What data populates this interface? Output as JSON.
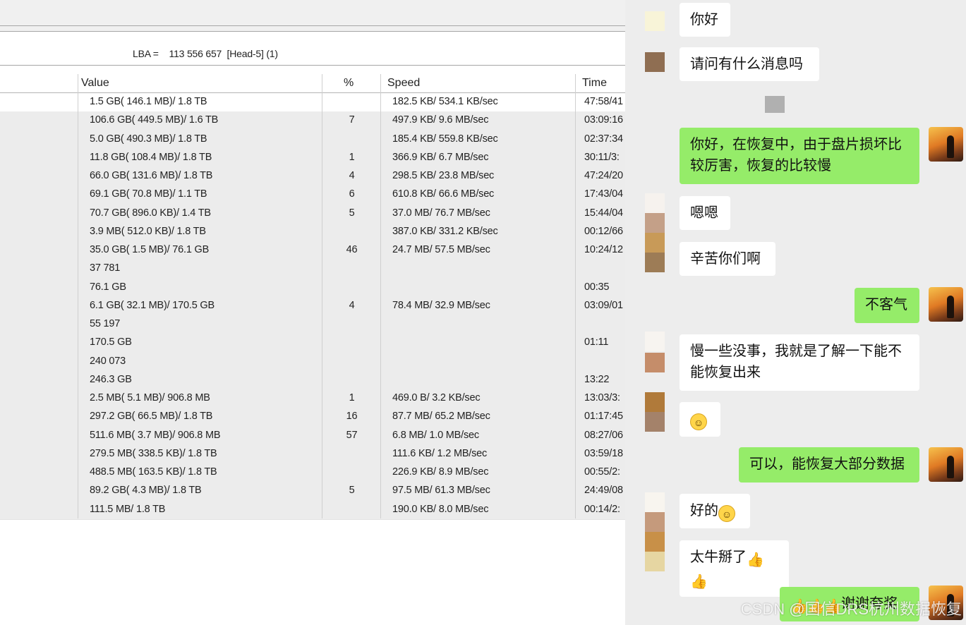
{
  "lba": {
    "label": "LBA =",
    "value": "113 556 657",
    "head": "[Head-5] (1)"
  },
  "table": {
    "headers": {
      "value": "Value",
      "pct": "%",
      "speed": "Speed",
      "time": "Time"
    },
    "rows": [
      {
        "value": "1.5 GB( 146.1 MB)/ 1.8 TB",
        "pct": "",
        "speed": "182.5 KB/ 534.1 KB/sec",
        "time": "47:58/41"
      },
      {
        "value": "106.6 GB( 449.5 MB)/ 1.6 TB",
        "pct": "7",
        "speed": "497.9 KB/ 9.6 MB/sec",
        "time": "03:09:16"
      },
      {
        "value": "5.0 GB( 490.3 MB)/ 1.8 TB",
        "pct": "",
        "speed": "185.4 KB/ 559.8 KB/sec",
        "time": "02:37:34"
      },
      {
        "value": "11.8 GB( 108.4 MB)/ 1.8 TB",
        "pct": "1",
        "speed": "366.9 KB/ 6.7 MB/sec",
        "time": "30:11/3:"
      },
      {
        "value": "66.0 GB( 131.6 MB)/ 1.8 TB",
        "pct": "4",
        "speed": "298.5 KB/ 23.8 MB/sec",
        "time": "47:24/20"
      },
      {
        "value": "69.1 GB( 70.8 MB)/ 1.1 TB",
        "pct": "6",
        "speed": "610.8 KB/ 66.6 MB/sec",
        "time": "17:43/04"
      },
      {
        "value": "70.7 GB( 896.0 KB)/ 1.4 TB",
        "pct": "5",
        "speed": "37.0 MB/ 76.7 MB/sec",
        "time": "15:44/04"
      },
      {
        "value": "3.9 MB( 512.0 KB)/ 1.8 TB",
        "pct": "",
        "speed": "387.0 KB/ 331.2 KB/sec",
        "time": "00:12/66"
      },
      {
        "value": "35.0 GB( 1.5 MB)/ 76.1 GB",
        "pct": "46",
        "speed": "24.7 MB/ 57.5 MB/sec",
        "time": "10:24/12"
      },
      {
        "value": "37 781",
        "pct": "",
        "speed": "",
        "time": ""
      },
      {
        "value": "76.1 GB",
        "pct": "",
        "speed": "",
        "time": "00:35"
      },
      {
        "value": "6.1 GB( 32.1 MB)/ 170.5 GB",
        "pct": "4",
        "speed": "78.4 MB/ 32.9 MB/sec",
        "time": "03:09/01"
      },
      {
        "value": "55 197",
        "pct": "",
        "speed": "",
        "time": ""
      },
      {
        "value": "170.5 GB",
        "pct": "",
        "speed": "",
        "time": "01:11"
      },
      {
        "value": "240 073",
        "pct": "",
        "speed": "",
        "time": ""
      },
      {
        "value": "246.3 GB",
        "pct": "",
        "speed": "",
        "time": "13:22"
      },
      {
        "value": "2.5 MB( 5.1 MB)/ 906.8 MB",
        "pct": "1",
        "speed": "469.0 B/ 3.2 KB/sec",
        "time": "13:03/3:"
      },
      {
        "value": "297.2 GB( 66.5 MB)/ 1.8 TB",
        "pct": "16",
        "speed": "87.7 MB/ 65.2 MB/sec",
        "time": "01:17:45"
      },
      {
        "value": "511.6 MB( 3.7 MB)/ 906.8 MB",
        "pct": "57",
        "speed": "6.8 MB/ 1.0 MB/sec",
        "time": "08:27/06"
      },
      {
        "value": "279.5 MB( 338.5 KB)/ 1.8 TB",
        "pct": "",
        "speed": "111.6 KB/ 1.2 MB/sec",
        "time": "03:59/18"
      },
      {
        "value": "488.5 MB( 163.5 KB)/ 1.8 TB",
        "pct": "",
        "speed": "226.9 KB/ 8.9 MB/sec",
        "time": "00:55/2:"
      },
      {
        "value": "89.2 GB( 4.3 MB)/ 1.8 TB",
        "pct": "5",
        "speed": "97.5 MB/ 61.3 MB/sec",
        "time": "24:49/08"
      },
      {
        "value": "111.5 MB/ 1.8 TB",
        "pct": "",
        "speed": "190.0 KB/ 8.0 MB/sec",
        "time": "00:14/2:"
      }
    ]
  },
  "chat": {
    "messages": [
      {
        "dir": "in",
        "text": "你好"
      },
      {
        "dir": "in",
        "text": "请问有什么消息吗"
      },
      {
        "dir": "out",
        "text": "你好，在恢复中，由于盘片损坏比较厉害，恢复的比较慢"
      },
      {
        "dir": "in",
        "text": "嗯嗯"
      },
      {
        "dir": "in",
        "text": "辛苦你们啊"
      },
      {
        "dir": "out",
        "text": "不客气"
      },
      {
        "dir": "in",
        "text": "慢一些没事，我就是了解一下能不能恢复出来"
      },
      {
        "dir": "in",
        "text": "",
        "emoji": "smile"
      },
      {
        "dir": "out",
        "text": "可以，能恢复大部分数据"
      },
      {
        "dir": "in",
        "text": "好的",
        "emoji": "smile"
      },
      {
        "dir": "in",
        "text": "太牛掰了",
        "emoji": "thumbs-up"
      },
      {
        "dir": "out",
        "text": "谢谢夸奖",
        "emoji": "thumbs-up"
      }
    ],
    "watermark": "CSDN @国信DRS杭州数据恢复"
  },
  "colors": {
    "incoming": "#ffffff",
    "outgoing": "#95ec69",
    "chat_bg": "#ededed"
  }
}
